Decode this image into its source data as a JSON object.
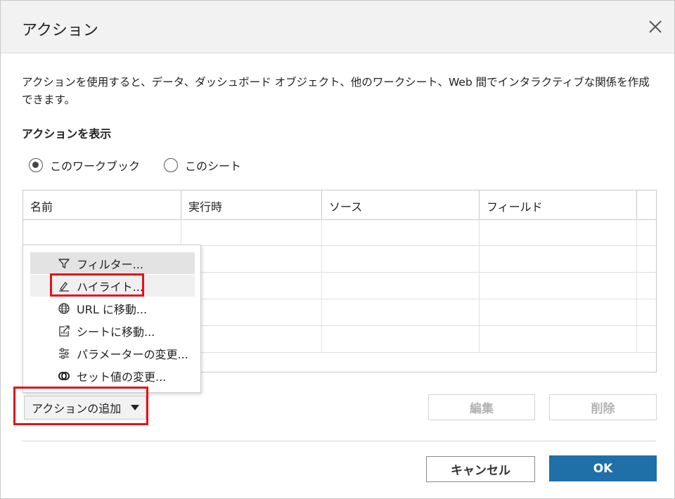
{
  "dialog": {
    "title": "アクション",
    "description": "アクションを使用すると、データ、ダッシュボード オブジェクト、他のワークシート、Web 間でインタラクティブな関係を作成できます。",
    "show_actions_label": "アクションを表示"
  },
  "radio": {
    "workbook_label": "このワークブック",
    "sheet_label": "このシート",
    "selected": "workbook"
  },
  "table": {
    "columns": [
      "名前",
      "実行時",
      "ソース",
      "フィールド",
      ""
    ]
  },
  "menu": {
    "items": [
      {
        "label": "フィルター...",
        "icon": "filter-icon"
      },
      {
        "label": "ハイライト...",
        "icon": "highlight-icon"
      },
      {
        "label": "URL に移動...",
        "icon": "globe-icon"
      },
      {
        "label": "シートに移動...",
        "icon": "sheet-link-icon"
      },
      {
        "label": "パラメーターの変更...",
        "icon": "sliders-icon"
      },
      {
        "label": "セット値の変更...",
        "icon": "set-icon"
      }
    ],
    "hovered_index": 0,
    "highlighted_index": 1
  },
  "buttons": {
    "add_action": "アクションの追加",
    "edit": "編集",
    "delete": "削除",
    "cancel": "キャンセル",
    "ok": "OK"
  },
  "colors": {
    "primary": "#1f6fa8",
    "annotation": "#e8101a"
  }
}
